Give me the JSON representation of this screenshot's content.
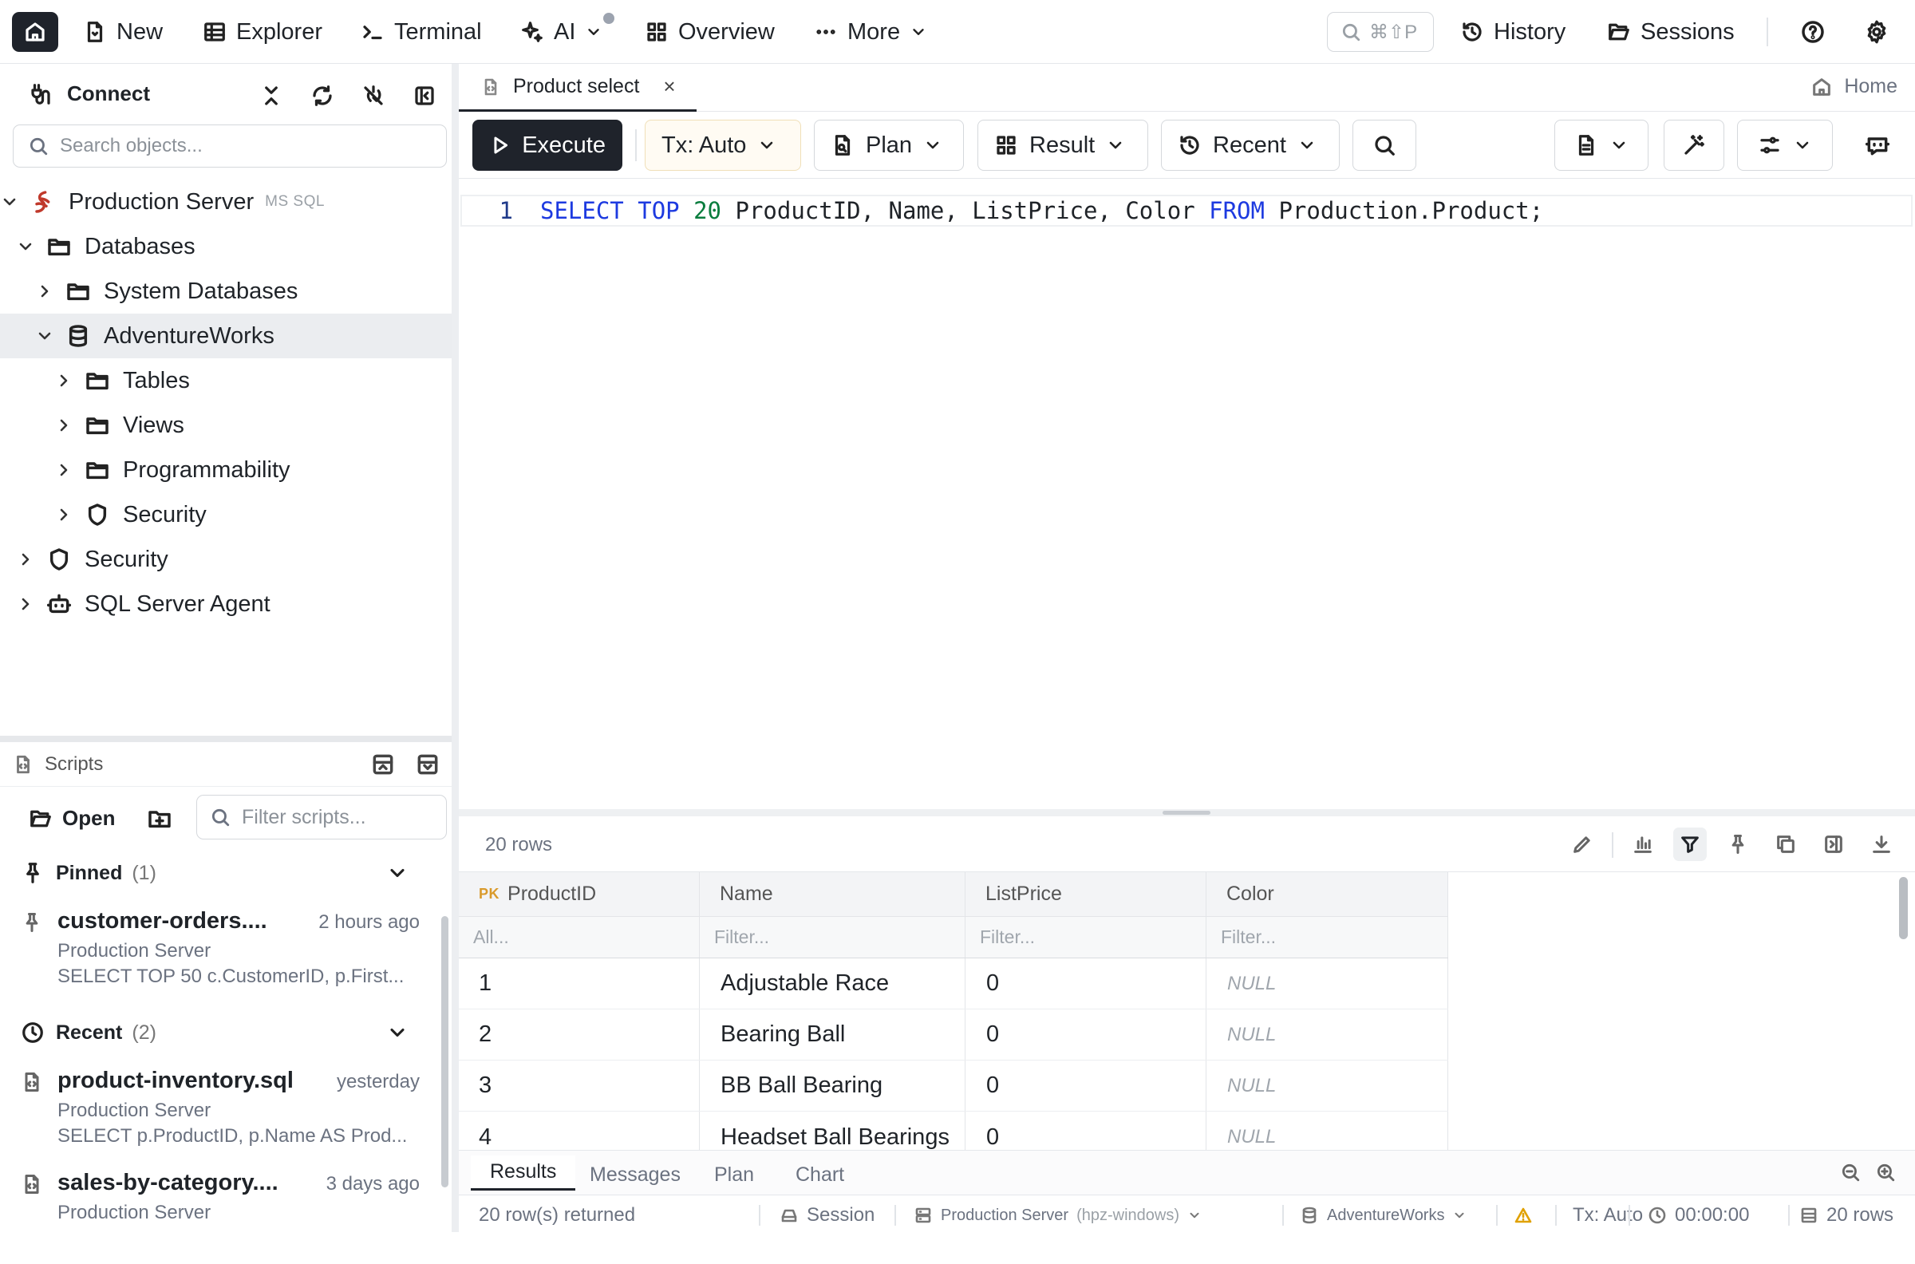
{
  "topbar": {
    "new": "New",
    "explorer": "Explorer",
    "terminal": "Terminal",
    "ai": "AI",
    "overview": "Overview",
    "more": "More",
    "search_shortcut": "⌘⇧P",
    "history": "History",
    "sessions": "Sessions"
  },
  "sidebar": {
    "connect": "Connect",
    "search_placeholder": "Search objects...",
    "tree": {
      "server": "Production Server",
      "server_type": "MS SQL",
      "databases": "Databases",
      "system_databases": "System Databases",
      "adventureworks": "AdventureWorks",
      "tables": "Tables",
      "views": "Views",
      "programmability": "Programmability",
      "security_db": "Security",
      "security": "Security",
      "agent": "SQL Server Agent"
    },
    "scripts": {
      "title": "Scripts",
      "open": "Open",
      "filter_placeholder": "Filter scripts...",
      "pinned_label": "Pinned",
      "pinned_count": "(1)",
      "recent_label": "Recent",
      "recent_count": "(2)",
      "pinned": [
        {
          "name": "customer-orders....",
          "when": "2 hours ago",
          "server": "Production Server",
          "sql": "SELECT TOP 50 c.CustomerID, p.First..."
        }
      ],
      "recent": [
        {
          "name": "product-inventory.sql",
          "when": "yesterday",
          "server": "Production Server",
          "sql": "SELECT p.ProductID, p.Name AS Prod..."
        },
        {
          "name": "sales-by-category....",
          "when": "3 days ago",
          "server": "Production Server",
          "sql": ""
        }
      ]
    }
  },
  "editor_tab": {
    "title": "Product select",
    "home": "Home"
  },
  "toolbar": {
    "execute": "Execute",
    "tx": "Tx: Auto",
    "plan": "Plan",
    "result": "Result",
    "recent": "Recent"
  },
  "editor": {
    "line_number": "1",
    "sql": {
      "select": "SELECT",
      "top": "TOP",
      "n": "20",
      "cols": "ProductID, Name, ListPrice, Color",
      "from": "FROM",
      "table": "Production.Product;"
    }
  },
  "results": {
    "row_count": "20 rows",
    "pk_badge": "PK",
    "columns": [
      "ProductID",
      "Name",
      "ListPrice",
      "Color"
    ],
    "filters": [
      "All...",
      "Filter...",
      "Filter...",
      "Filter..."
    ],
    "rows": [
      [
        "1",
        "Adjustable Race",
        "0",
        "NULL"
      ],
      [
        "2",
        "Bearing Ball",
        "0",
        "NULL"
      ],
      [
        "3",
        "BB Ball Bearing",
        "0",
        "NULL"
      ],
      [
        "4",
        "Headset Ball Bearings",
        "0",
        "NULL"
      ]
    ],
    "tabs": [
      "Results",
      "Messages",
      "Plan",
      "Chart"
    ]
  },
  "statusbar": {
    "returned": "20 row(s) returned",
    "session": "Session",
    "server": "Production Server",
    "host": "(hpz-windows)",
    "database": "AdventureWorks",
    "tx": "Tx: Auto",
    "elapsed": "00:00:00",
    "rows": "20 rows"
  },
  "colors": {
    "accent": "#1f232b",
    "keyword": "#1d3ae0",
    "number": "#0a7d3e",
    "pk": "#d99a2b",
    "tx_bg": "#fffbf3"
  }
}
